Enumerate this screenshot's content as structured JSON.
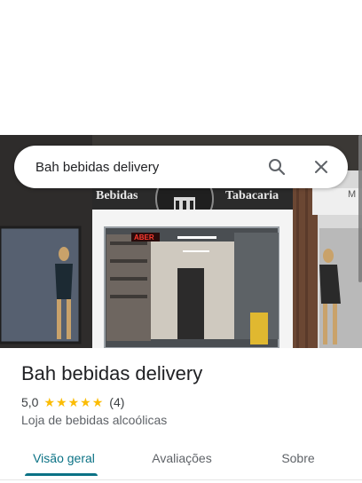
{
  "search": {
    "query": "Bah bebidas delivery"
  },
  "place": {
    "name": "Bah bebidas delivery",
    "rating": "5,0",
    "stars": 5,
    "review_count": "(4)",
    "category": "Loja de bebidas alcoólicas"
  },
  "storefront": {
    "sign_left": "Bebidas",
    "sign_right": "Tabacaria",
    "open_sign": "ABER"
  },
  "tabs": [
    {
      "label": "Visão geral",
      "active": true
    },
    {
      "label": "Avaliações",
      "active": false
    },
    {
      "label": "Sobre",
      "active": false
    }
  ],
  "colors": {
    "accent": "#0b7285",
    "star": "#fbbc04"
  }
}
